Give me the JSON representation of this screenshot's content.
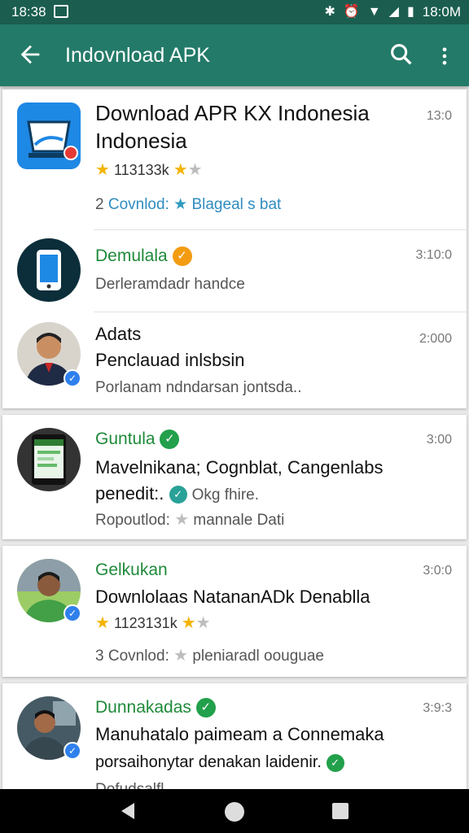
{
  "status_bar": {
    "time": "18:38",
    "right_time": "18:0M"
  },
  "app_bar": {
    "title": "Indovnload APK"
  },
  "colors": {
    "app_bar": "#237a68",
    "status_bar": "#1b5e4f",
    "green_name": "#1f8a3a",
    "star": "#f4b400"
  },
  "items": [
    {
      "title_line1": "Download APR KX Indonesia",
      "title_line2": "Indonesia",
      "time": "13:0",
      "rating_text": "113133k",
      "download_prefix": "2",
      "download_label": "Covnlod:",
      "download_value": "Blageal s bat"
    },
    {
      "name": "Demulala",
      "time": "3:10:0",
      "sub": "Derleramdadr handce"
    },
    {
      "name": "Adats",
      "line2": "Penclauad inlsbsin",
      "sub": "Porlanam ndndarsan jontsda..",
      "time": "2:000"
    },
    {
      "name": "Guntula",
      "time": "3:00",
      "line2": "Mavelnikana; Cognblat, Cangenlabs",
      "line3_a": "penedit:.",
      "line3_b": "Okg fhire.",
      "sub": "Ropoutlod:",
      "sub_tail": "mannale Dati"
    },
    {
      "name": "Gelkukan",
      "time": "3:0:0",
      "line2": "Downlolaas NatananADk Denablla",
      "rating_text": "1123131k",
      "download_prefix": "3",
      "download_label": "Covnlod:",
      "download_value": "pleniaradl oouguae"
    },
    {
      "name": "Dunnakadas",
      "time": "3:9:3",
      "line2": "Manuhatalo paimeam a Connemaka",
      "line3": "porsaihonytar denakan laidenir.",
      "sub": "Dofudsalfl"
    }
  ]
}
